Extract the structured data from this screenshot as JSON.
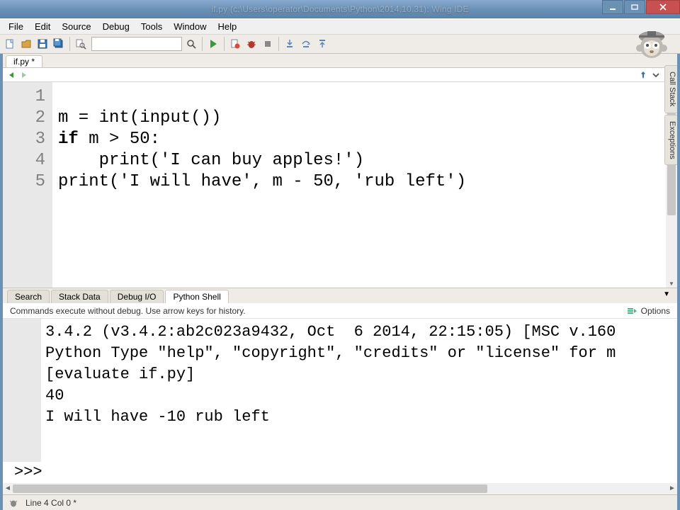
{
  "title": "if.py (c:\\Users\\operator\\Documents\\Python\\2014.10.31): Wing IDE",
  "menus": [
    "File",
    "Edit",
    "Source",
    "Debug",
    "Tools",
    "Window",
    "Help"
  ],
  "file_tab": "if.py *",
  "code": {
    "lines": [
      {
        "n": "1",
        "text": "m = int(input())"
      },
      {
        "n": "2",
        "text": "if m > 50:"
      },
      {
        "n": "3",
        "text": "    print('I can buy apples!')"
      },
      {
        "n": "4",
        "text": "print('I will have', m - 50, 'rub left')"
      },
      {
        "n": "5",
        "text": ""
      }
    ]
  },
  "bottom_tabs": [
    "Search",
    "Stack Data",
    "Debug I/O",
    "Python Shell"
  ],
  "active_bottom_tab": 3,
  "shell": {
    "hint": "Commands execute without debug.  Use arrow keys for history.",
    "options_label": "Options",
    "lines": [
      "3.4.2 (v3.4.2:ab2c023a9432, Oct  6 2014, 22:15:05) [MSC v.160",
      "Python Type \"help\", \"copyright\", \"credits\" or \"license\" for m",
      "[evaluate if.py]",
      "40",
      "I will have -10 rub left"
    ],
    "prompt": ">>>"
  },
  "status": "Line 4 Col 0 *",
  "side_tabs": [
    "Call Stack",
    "Exceptions"
  ]
}
